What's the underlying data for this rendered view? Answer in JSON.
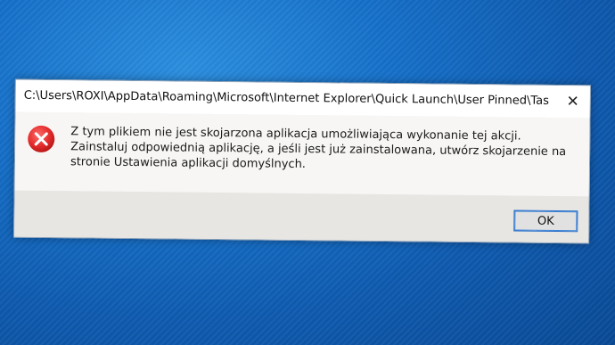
{
  "dialog": {
    "title": "C:\\Users\\ROXI\\AppData\\Roaming\\Microsoft\\Internet Explorer\\Quick Launch\\User Pinned\\Task...",
    "close_label": "✕",
    "message": "Z tym plikiem nie jest skojarzona aplikacja umożliwiająca wykonanie tej akcji. Zainstaluj odpowiednią aplikację, a jeśli jest już zainstalowana, utwórz skojarzenie na stronie Ustawienia aplikacji domyślnych.",
    "ok_label": "OK",
    "icon": "error-icon"
  },
  "colors": {
    "error_red": "#e32b2b",
    "desktop_blue": "#1670c9",
    "focus_border": "#2a6fc9"
  }
}
